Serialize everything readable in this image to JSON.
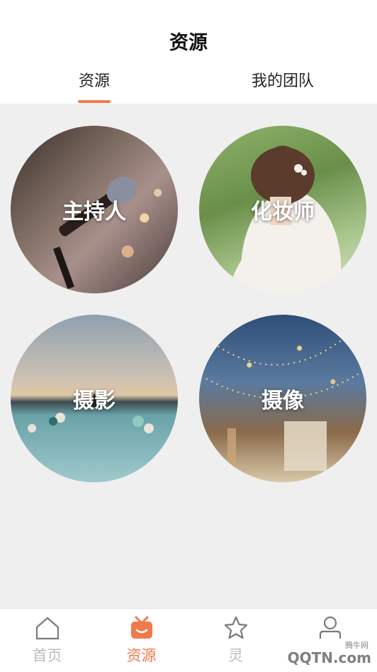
{
  "header": {
    "title": "资源",
    "tabs": [
      {
        "label": "资源",
        "active": true
      },
      {
        "label": "我的团队",
        "active": false
      }
    ]
  },
  "categories": [
    {
      "label": "主持人",
      "image": "microphone-photo"
    },
    {
      "label": "化妆师",
      "image": "bridal-hairstyle-photo"
    },
    {
      "label": "摄影",
      "image": "balloons-reflection-photo"
    },
    {
      "label": "摄像",
      "image": "wedding-decor-photo"
    }
  ],
  "tabbar": {
    "items": [
      {
        "label": "首页",
        "icon": "home-icon",
        "active": false
      },
      {
        "label": "资源",
        "icon": "resources-icon",
        "active": true
      },
      {
        "label": "灵",
        "icon": "star-icon",
        "active": false
      },
      {
        "label": "",
        "icon": "user-icon",
        "active": false
      }
    ]
  },
  "watermark": {
    "text": "QQTN.com",
    "small": "腾牛网"
  },
  "colors": {
    "accent": "#f07a4b",
    "inactive": "#bcbcbc",
    "background": "#efefef"
  }
}
